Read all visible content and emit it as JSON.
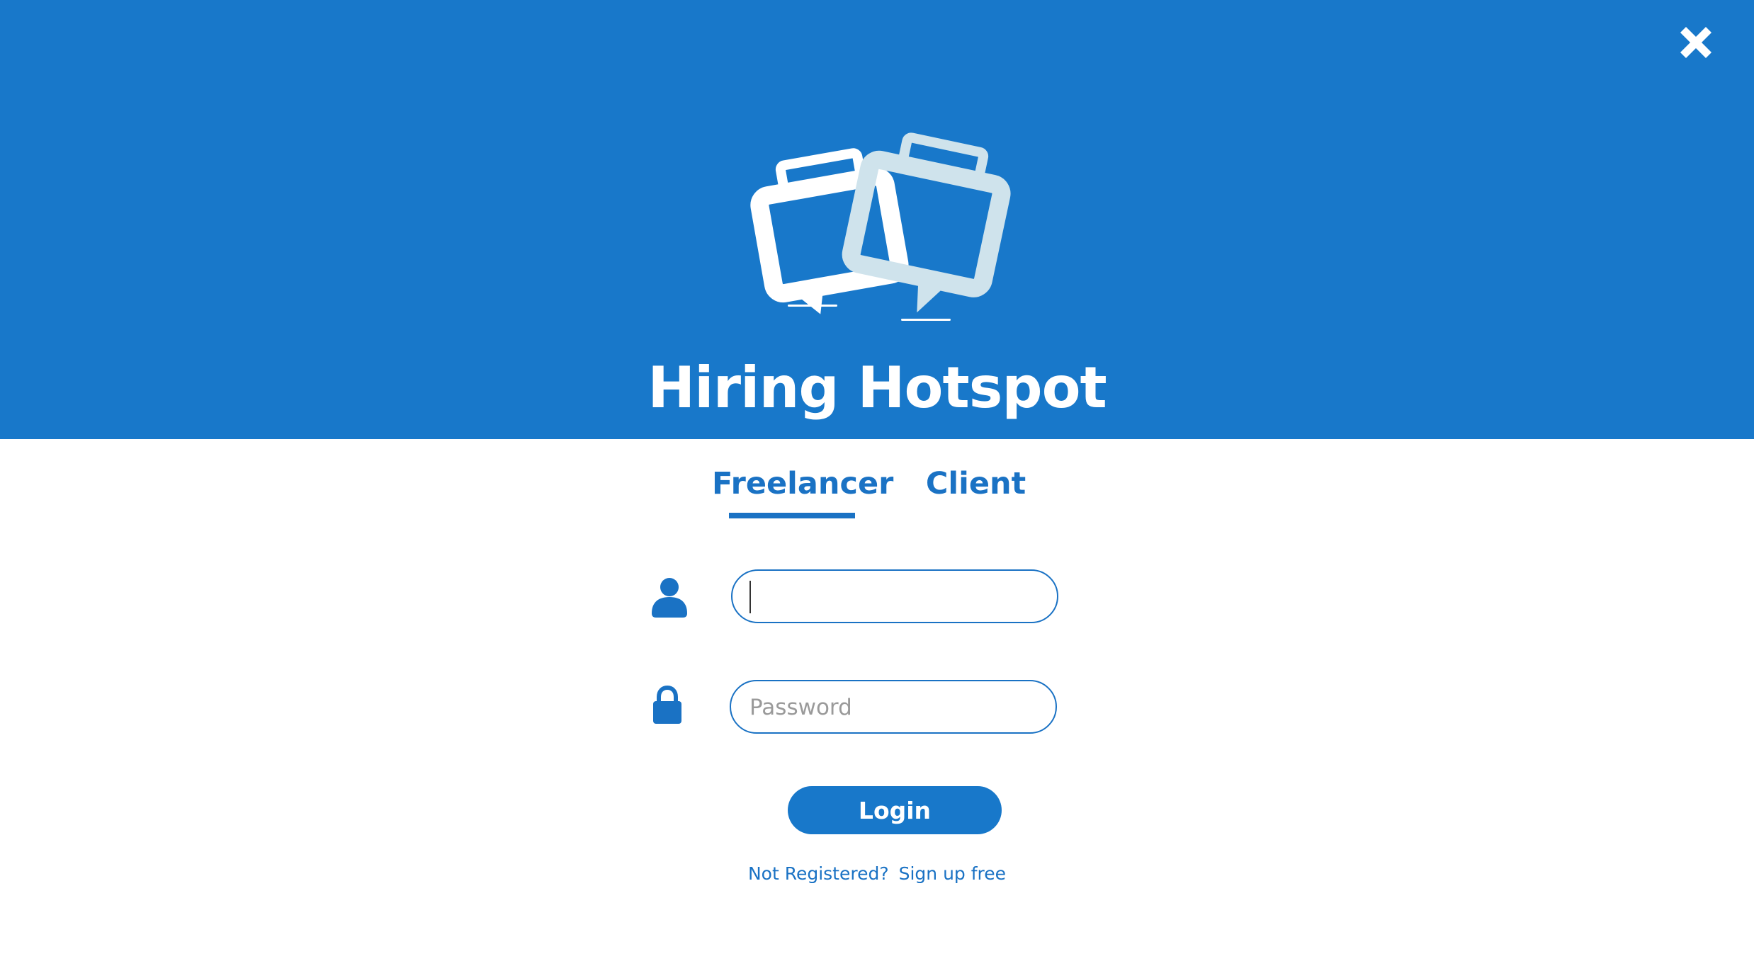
{
  "app": {
    "title": "Hiring Hotspot"
  },
  "tabs": [
    {
      "label": "Freelancer",
      "active": true
    },
    {
      "label": "Client",
      "active": false
    }
  ],
  "form": {
    "username": {
      "value": "",
      "placeholder": ""
    },
    "password": {
      "value": "",
      "placeholder": "Password"
    },
    "login_label": "Login"
  },
  "register": {
    "prompt": "Not Registered?",
    "link_label": "Sign up free"
  },
  "icons": {
    "close": "close-icon",
    "logo": "chat-briefcase-logo",
    "user": "user-icon",
    "lock": "lock-icon"
  },
  "colors": {
    "brand": "#1878ca",
    "accent_text": "#1a72c4",
    "logo_white": "#ffffff",
    "logo_light": "#cfe3ec"
  }
}
